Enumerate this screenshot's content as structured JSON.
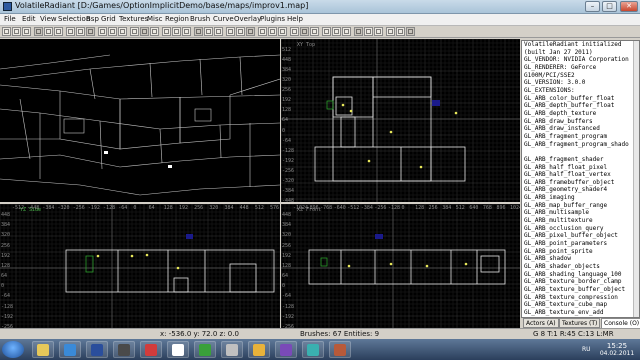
{
  "window": {
    "title": "VolatileRadiant [D:/Games/OptionImplicitDemo/base/maps/improv1.map]",
    "minimize": "–",
    "maximize": "□",
    "close": "✕"
  },
  "menu": [
    "File",
    "Edit",
    "View",
    "Selection",
    "Bsp",
    "Grid",
    "Textures",
    "Misc",
    "Region",
    "Brush",
    "Curve",
    "Overlay",
    "Plugins",
    "Help"
  ],
  "viewports": {
    "xy_label": "XY Top",
    "yz_label": "YZ Side",
    "xz_label": "XZ Front",
    "yz_ruler": [
      "448",
      "384",
      "320",
      "256",
      "192",
      "128",
      "64",
      "0",
      "-64",
      "-128",
      "-192",
      "-256"
    ],
    "xy_ruler_left": [
      "512",
      "448",
      "384",
      "320",
      "256",
      "192",
      "128",
      "64",
      "0",
      "-64",
      "-128",
      "-192",
      "-256",
      "-320",
      "-384",
      "-448"
    ],
    "xz_ruler_left": [
      "448",
      "384",
      "320",
      "256",
      "192",
      "128",
      "64",
      "0",
      "-64",
      "-128",
      "-192",
      "-256"
    ],
    "top_ruler_yz": [
      "-512",
      "-448",
      "-384",
      "-320",
      "-256",
      "-192",
      "-128",
      "-64",
      "0",
      "64",
      "128",
      "192",
      "256",
      "320",
      "384",
      "448",
      "512",
      "576"
    ],
    "top_ruler_xz": [
      "-1024",
      "-896",
      "-768",
      "-640",
      "-512",
      "-384",
      "-256",
      "-128",
      "0",
      "128",
      "256",
      "384",
      "512",
      "640",
      "768",
      "896",
      "1024"
    ]
  },
  "console": {
    "lines": [
      "VolatileRadiant initialized",
      "(built Jan 27 2011)",
      "GL_VENDOR: NVIDIA Corporation",
      "GL_RENDERER: GeForce",
      "G100M/PCI/SSE2",
      "GL_VERSION: 3.0.0",
      "GL_EXTENSIONS:",
      "GL_ARB_color_buffer_float",
      "GL_ARB_depth_buffer_float",
      "GL_ARB_depth_texture",
      "GL_ARB_draw_buffers",
      "GL_ARB_draw_instanced",
      "GL_ARB_fragment_program",
      "GL_ARB_fragment_program_shado",
      "",
      "GL_ARB_fragment_shader",
      "GL_ARB_half_float_pixel",
      "GL_ARB_half_float_vertex",
      "GL_ARB_framebuffer_object",
      "GL_ARB_geometry_shader4",
      "GL_ARB_imaging",
      "GL_ARB_map_buffer_range",
      "GL_ARB_multisample",
      "GL_ARB_multitexture",
      "GL_ARB_occlusion_query",
      "GL_ARB_pixel_buffer_object",
      "GL_ARB_point_parameters",
      "GL_ARB_point_sprite",
      "GL_ARB_shadow",
      "GL_ARB_shader_objects",
      "GL_ARB_shading_language_100",
      "GL_ARB_texture_border_clamp",
      "GL_ARB_texture_buffer_object",
      "GL_ARB_texture_compression",
      "GL_ARB_texture_cube_map",
      "GL_ARB_texture_env_add",
      "GL_ARB_texture_env_combine",
      "GL_ARB_texture_env_dot3",
      "GL_ARB_texture_float",
      "GL_ARB_texture_mirrored_repea"
    ]
  },
  "tabs": [
    "Actors (A)",
    "Textures (T)",
    "Console (O)"
  ],
  "status": {
    "coords": "x: -536.0  y: 72.0  z: 0.0",
    "brushes": "Brushes: 67 Entities: 9",
    "grid": "G 8 T:1 R:45 C:13 L:MR"
  },
  "tray": {
    "lang": "RU",
    "time": "15:25",
    "date": "04.02.2011"
  },
  "taskbar_apps": [
    "explorer",
    "media",
    "photoshop",
    "radiant",
    "app",
    "chrome",
    "notepad",
    "game",
    "folder",
    "tool",
    "app2",
    "app3"
  ]
}
